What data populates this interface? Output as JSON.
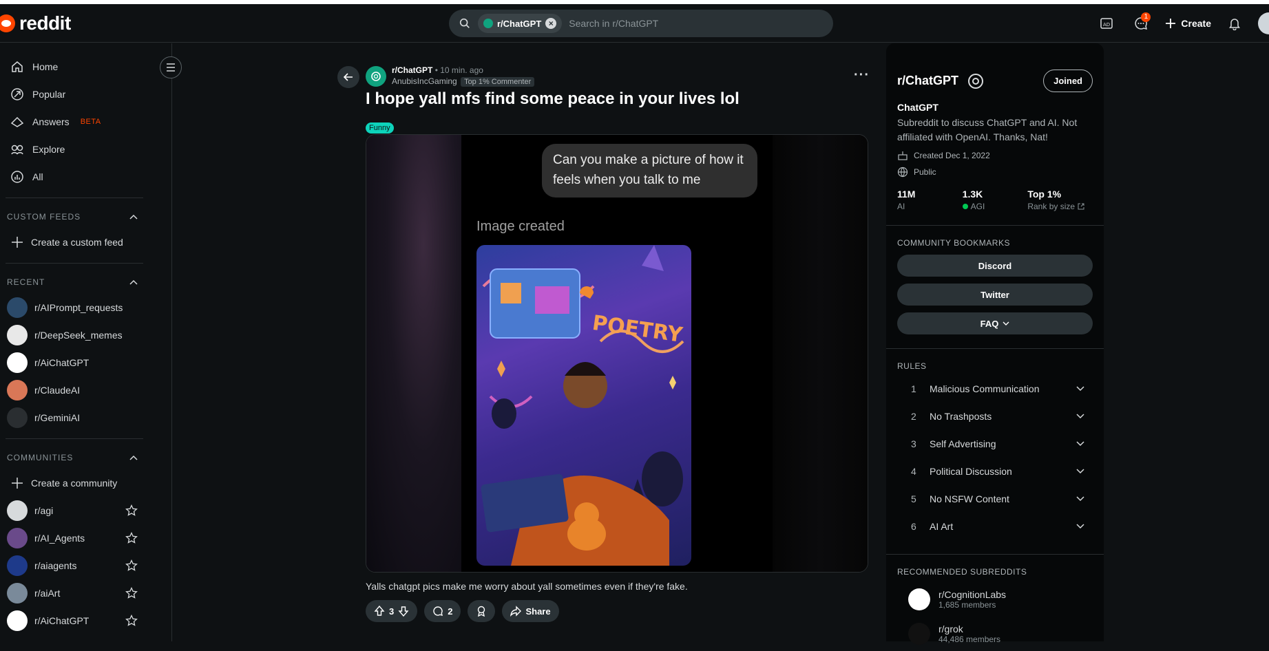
{
  "header": {
    "logo_text": "reddit",
    "search_chip": "r/ChatGPT",
    "search_placeholder": "Search in r/ChatGPT",
    "chat_badge": "1",
    "create_label": "Create"
  },
  "sidebar": {
    "nav": [
      {
        "label": "Home",
        "icon": "home-icon"
      },
      {
        "label": "Popular",
        "icon": "popular-icon"
      },
      {
        "label": "Answers",
        "icon": "answers-icon",
        "tag": "BETA"
      },
      {
        "label": "Explore",
        "icon": "explore-icon"
      },
      {
        "label": "All",
        "icon": "all-icon"
      }
    ],
    "custom_feeds_title": "CUSTOM FEEDS",
    "create_custom_feed": "Create a custom feed",
    "recent_title": "RECENT",
    "recent": [
      {
        "name": "r/AIPrompt_requests",
        "color": "#2b4a6a"
      },
      {
        "name": "r/DeepSeek_memes",
        "color": "#e8e8e8"
      },
      {
        "name": "r/AiChatGPT",
        "color": "#ffffff"
      },
      {
        "name": "r/ClaudeAI",
        "color": "#d97757"
      },
      {
        "name": "r/GeminiAI",
        "color": "#2a2e31"
      }
    ],
    "communities_title": "COMMUNITIES",
    "create_community": "Create a community",
    "communities": [
      {
        "name": "r/agi",
        "color": "#d7dadc"
      },
      {
        "name": "r/AI_Agents",
        "color": "#6a4a8a"
      },
      {
        "name": "r/aiagents",
        "color": "#1e3a8a"
      },
      {
        "name": "r/aiArt",
        "color": "#7a8a9a"
      },
      {
        "name": "r/AiChatGPT",
        "color": "#ffffff"
      }
    ]
  },
  "post": {
    "subreddit": "r/ChatGPT",
    "time": "• 10 min. ago",
    "author": "AnubisIncGaming",
    "author_flair": "Top 1% Commenter",
    "title": "I hope yall mfs find some peace in your lives lol",
    "flair": "Funny",
    "bubble_text": "Can you make a picture of how it feels when you talk to me",
    "image_created": "Image created",
    "art_word": "POETRY",
    "caption": "Yalls chatgpt pics make me worry about yall sometimes even if they're fake.",
    "upvotes": "3",
    "comments": "2",
    "share_label": "Share"
  },
  "rightbar": {
    "title": "r/ChatGPT",
    "joined_label": "Joined",
    "name": "ChatGPT",
    "description": "Subreddit to discuss ChatGPT and AI. Not affiliated with OpenAI. Thanks, Nat!",
    "created": "Created Dec 1, 2022",
    "visibility": "Public",
    "stats": [
      {
        "value": "11M",
        "label": "AI"
      },
      {
        "value": "1.3K",
        "label": "AGI"
      },
      {
        "value": "Top 1%",
        "label": "Rank by size"
      }
    ],
    "bookmarks_title": "COMMUNITY BOOKMARKS",
    "bookmarks": [
      "Discord",
      "Twitter",
      "FAQ"
    ],
    "rules_title": "RULES",
    "rules": [
      {
        "n": "1",
        "t": "Malicious Communication"
      },
      {
        "n": "2",
        "t": "No Trashposts"
      },
      {
        "n": "3",
        "t": "Self Advertising"
      },
      {
        "n": "4",
        "t": "Political Discussion"
      },
      {
        "n": "5",
        "t": "No NSFW Content"
      },
      {
        "n": "6",
        "t": "AI Art"
      }
    ],
    "recommended_title": "RECOMMENDED SUBREDDITS",
    "recommended": [
      {
        "name": "r/CognitionLabs",
        "members": "1,685 members",
        "color": "#ffffff"
      },
      {
        "name": "r/grok",
        "members": "44,486 members",
        "color": "#111111"
      }
    ]
  },
  "colors": {
    "accent": "#ff4500",
    "chatgpt": "#10a37f",
    "funny_flair": "#0dd3bb"
  }
}
